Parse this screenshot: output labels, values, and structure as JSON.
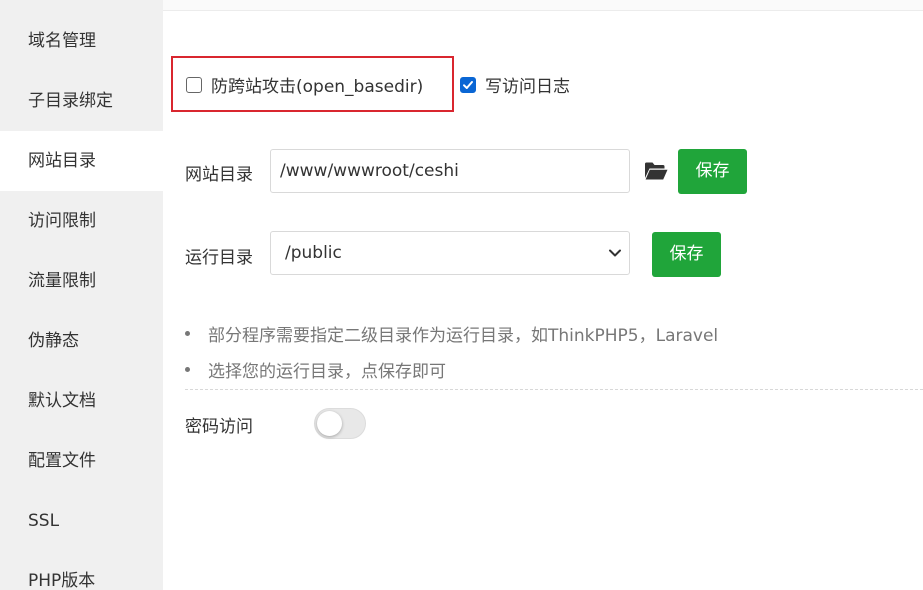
{
  "sidebar": {
    "items": [
      {
        "label": "域名管理",
        "active": false
      },
      {
        "label": "子目录绑定",
        "active": false
      },
      {
        "label": "网站目录",
        "active": true
      },
      {
        "label": "访问限制",
        "active": false
      },
      {
        "label": "流量限制",
        "active": false
      },
      {
        "label": "伪静态",
        "active": false
      },
      {
        "label": "默认文档",
        "active": false
      },
      {
        "label": "配置文件",
        "active": false
      },
      {
        "label": "SSL",
        "active": false
      },
      {
        "label": "PHP版本",
        "active": false
      }
    ]
  },
  "options": {
    "anti_xss": {
      "label": "防跨站攻击(open_basedir)",
      "checked": false
    },
    "access_log": {
      "label": "写访问日志",
      "checked": true
    }
  },
  "site_dir": {
    "label": "网站目录",
    "value": "/www/wwwroot/ceshi",
    "folder_icon": "folder-open-icon",
    "save_label": "保存"
  },
  "run_dir": {
    "label": "运行目录",
    "selected": "/public",
    "save_label": "保存"
  },
  "notes": [
    "部分程序需要指定二级目录作为运行目录，如ThinkPHP5，Laravel",
    "选择您的运行目录，点保存即可"
  ],
  "password_access": {
    "label": "密码访问",
    "enabled": false
  },
  "colors": {
    "save_button": "#20a53a",
    "checkbox_checked": "#0a66d4",
    "highlight_border": "#d9262f"
  }
}
